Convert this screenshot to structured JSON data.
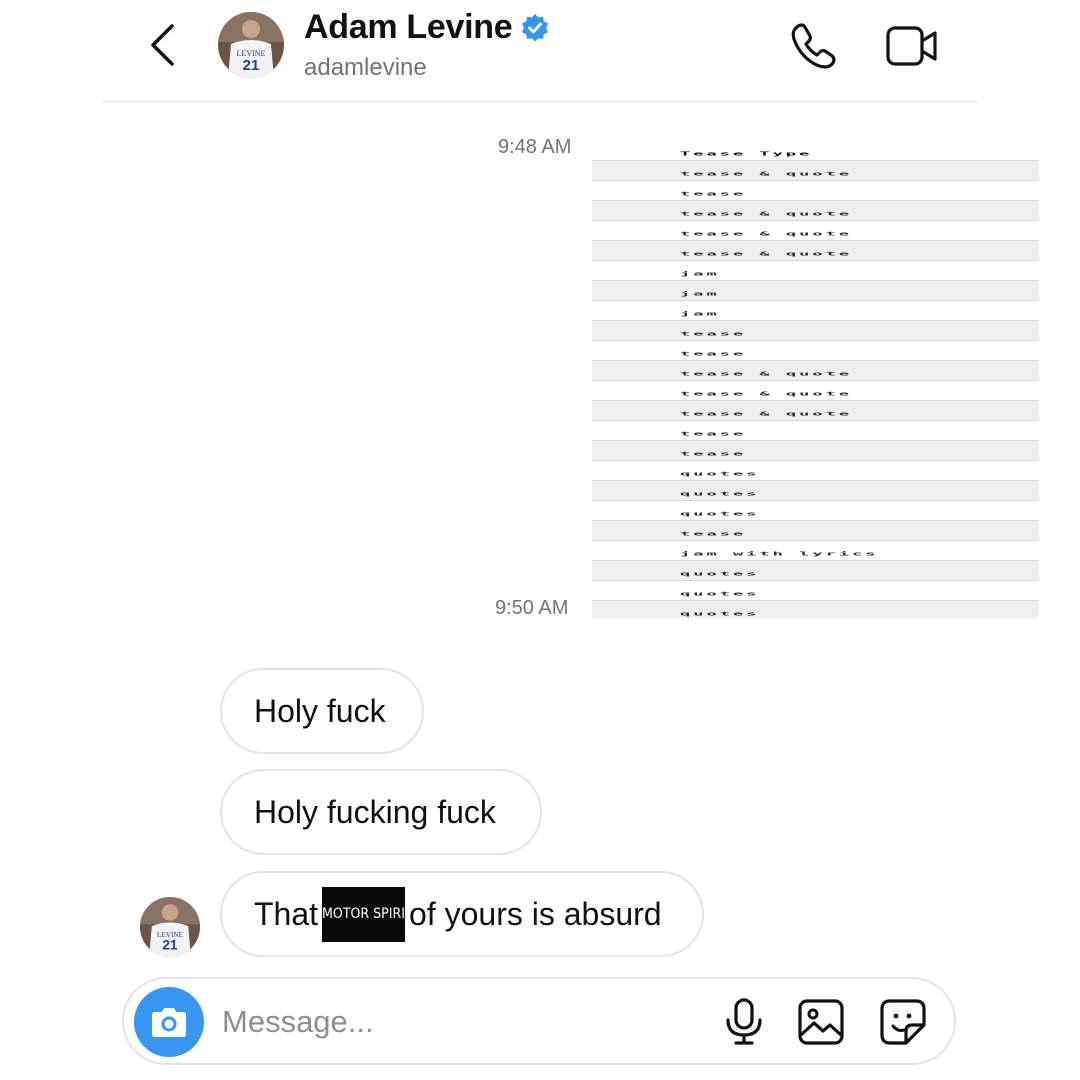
{
  "header": {
    "name": "Adam Levine",
    "username": "adamlevine",
    "verified": true,
    "avatar": {
      "jersey_text": "LEVINE",
      "jersey_number": "21"
    }
  },
  "timestamps": [
    "9:48 AM",
    "9:50 AM"
  ],
  "shared_image": {
    "header": "Tease Type",
    "rows": [
      "tease & quote",
      "tease",
      "tease & quote",
      "tease & quote",
      "tease & quote",
      "jam",
      "jam",
      "jam",
      "tease",
      "tease",
      "tease & quote",
      "tease & quote",
      "tease & quote",
      "tease",
      "tease",
      "quotes",
      "quotes",
      "quotes",
      "tease",
      "jam with lyrics",
      "quotes",
      "quotes",
      "quotes"
    ]
  },
  "messages": [
    {
      "text": "Holy fuck"
    },
    {
      "text": "Holy fucking fuck"
    },
    {
      "before": "That",
      "redacted": "MOTOR SPIRIT",
      "after": "of yours is absurd"
    }
  ],
  "composer": {
    "placeholder": "Message..."
  },
  "colors": {
    "accent": "#3797f0",
    "verified": "#3797f0",
    "border": "#e3e3e3",
    "muted": "#737373"
  }
}
